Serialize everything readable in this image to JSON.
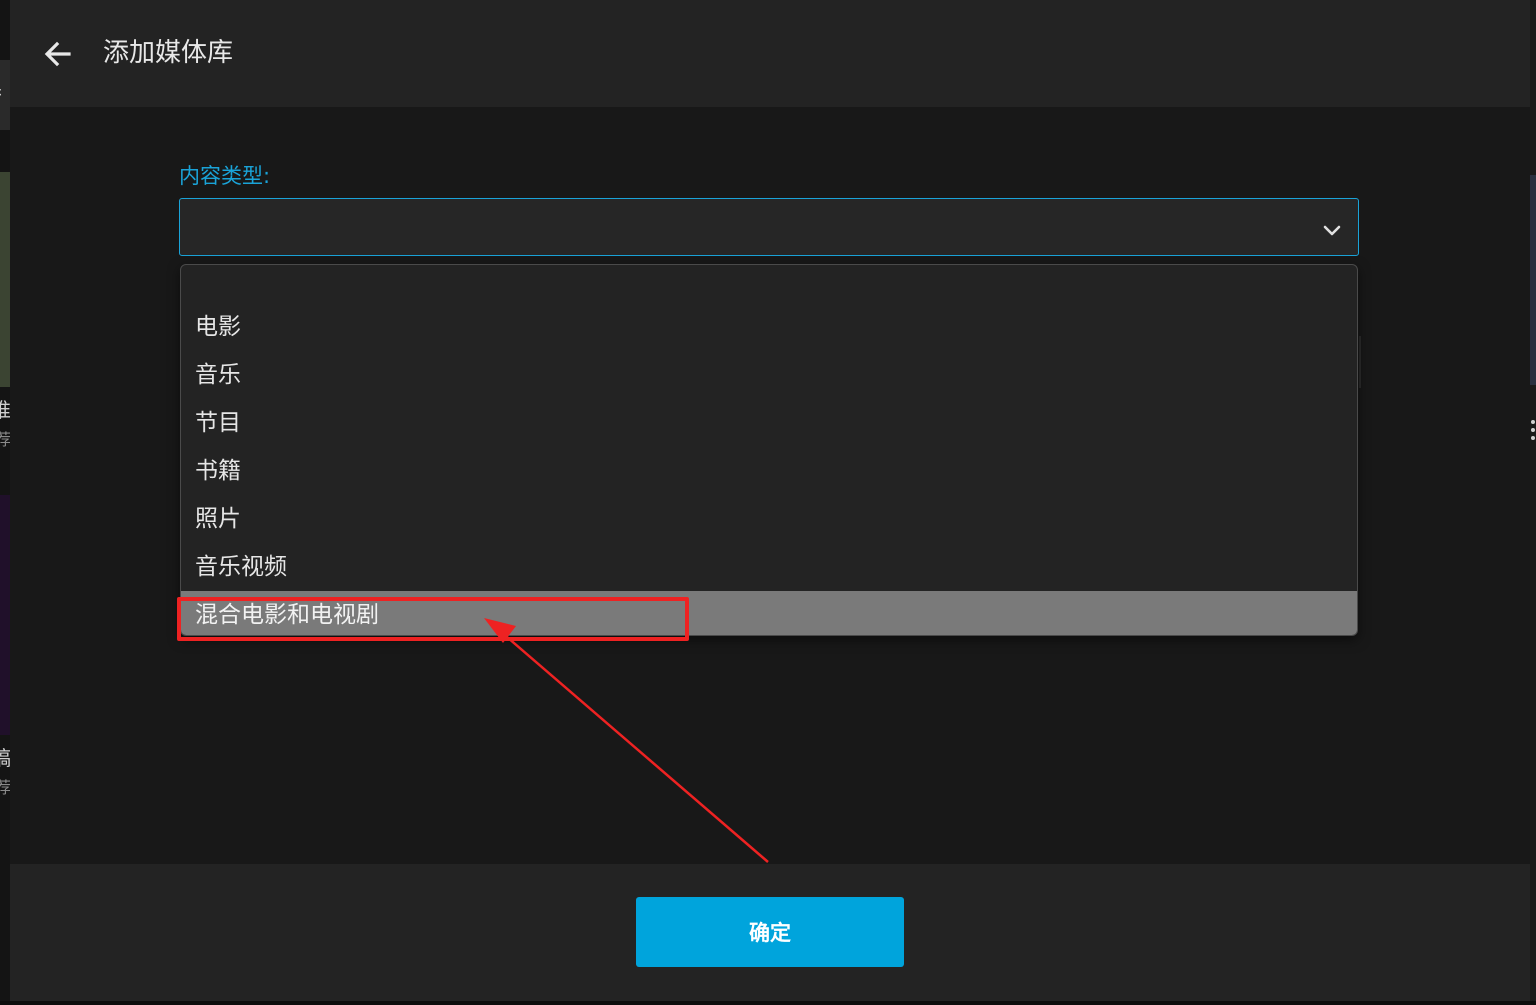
{
  "dialog": {
    "title": "添加媒体库",
    "back_icon": "arrow-left-icon"
  },
  "content_type": {
    "label": "内容类型:",
    "value": "",
    "options": [
      "",
      "电影",
      "音乐",
      "节目",
      "书籍",
      "照片",
      "音乐视频",
      "混合电影和电视剧"
    ],
    "highlighted_option": "混合电影和电视剧"
  },
  "footer": {
    "confirm_label": "确定"
  },
  "background_fragments": [
    "扌",
    "推",
    "荐",
    "稿",
    "荐"
  ],
  "colors": {
    "accent": "#00a4dc",
    "label": "#1aa3d8",
    "highlight": "#7a7a7a",
    "annotation": "#ee2222"
  }
}
